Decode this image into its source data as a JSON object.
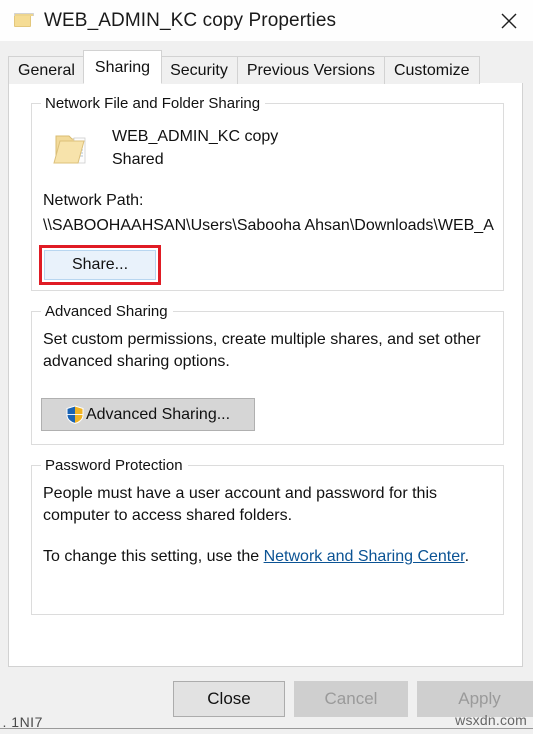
{
  "window": {
    "title": "WEB_ADMIN_KC copy Properties",
    "folder_icon": "folder-icon",
    "close_icon": "close-icon"
  },
  "tabs": [
    {
      "label": "General",
      "active": false
    },
    {
      "label": "Sharing",
      "active": true
    },
    {
      "label": "Security",
      "active": false
    },
    {
      "label": "Previous Versions",
      "active": false
    },
    {
      "label": "Customize",
      "active": false
    }
  ],
  "network_sharing": {
    "group_title": "Network File and Folder Sharing",
    "folder_icon": "folder-icon",
    "share_name": "WEB_ADMIN_KC copy",
    "share_state": "Shared",
    "network_path_label": "Network Path:",
    "network_path_value": "\\\\SABOOHAAHSAN\\Users\\Sabooha Ahsan\\Downloads\\WEB_A",
    "share_button": "Share..."
  },
  "advanced_sharing": {
    "group_title": "Advanced Sharing",
    "description": "Set custom permissions, create multiple shares, and set other advanced sharing options.",
    "button_label": "Advanced Sharing...",
    "button_icon": "uac-shield-icon"
  },
  "password_protection": {
    "group_title": "Password Protection",
    "description": "People must have a user account and password for this computer to access shared folders.",
    "change_prefix": "To change this setting, use the ",
    "change_link": "Network and Sharing Center",
    "change_suffix": "."
  },
  "footer": {
    "close": "Close",
    "cancel": "Cancel",
    "apply": "Apply"
  },
  "overlay": {
    "watermark": "wsxdn.com",
    "artifact": "\u0007, 1NI7"
  },
  "colors": {
    "accent_highlight": "#e01b24",
    "link": "#0b5394",
    "dialog_bg": "#f0f0f0",
    "panel_bg": "#ffffff",
    "share_button_bg": "#e9f2fb"
  }
}
